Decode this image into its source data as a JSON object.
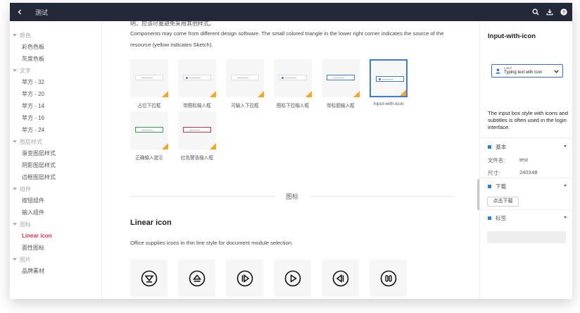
{
  "topbar": {
    "title": "测试",
    "back_icon": "chevron-left-icon",
    "actions": [
      "search-icon",
      "download-icon",
      "help-icon"
    ]
  },
  "sidebar": {
    "groups": [
      {
        "label": "颜色",
        "items": [
          "彩色色板",
          "灰度色板"
        ]
      },
      {
        "label": "文字",
        "items": [
          "苹方 - 32",
          "苹方 - 20",
          "苹方 - 14",
          "苹方 - 16",
          "苹方 - 24"
        ]
      },
      {
        "label": "图层样式",
        "items": [
          "渐变图层样式",
          "阴影图层样式",
          "边框图层样式"
        ]
      },
      {
        "label": "组件",
        "items": [
          "按钮组件",
          "输入组件"
        ]
      },
      {
        "label": "图标",
        "items": [
          "Linear icon",
          "面性图标"
        ]
      },
      {
        "label": "图片",
        "items": [
          "品牌素材"
        ]
      }
    ],
    "active_item": "Linear icon"
  },
  "main": {
    "intro_cut": "明，应该尽量避免采用其他样式。",
    "intro": "Components may come from different design software. The small colored triangle in the lower right corner indicates the source of the resource (yellow indicates Sketch).",
    "thumbnails": [
      {
        "label": "占位下拉框"
      },
      {
        "label": "带图标输入框"
      },
      {
        "label": "可输入下拉框"
      },
      {
        "label": "图标下拉输入框"
      },
      {
        "label": "带标题输入框"
      },
      {
        "label": "Input-with-icon"
      },
      {
        "label": "正确输入提示"
      },
      {
        "label": "红色警告输入框"
      }
    ],
    "divider_label": "图标",
    "section_title": "Linear icon",
    "section_desc": "Office supplies icons in thin line style for document module selection.",
    "icons": [
      "filter-circle-icon",
      "eject-circle-icon",
      "play-step-circle-icon",
      "play-circle-icon",
      "rewind-circle-icon",
      "pause-circle-icon"
    ]
  },
  "colors": {
    "topbar": "#232938",
    "active": "#e5304a",
    "accent": "#2f7fe0",
    "sketch": "#f5a623"
  },
  "detail": {
    "title": "Input-with-icon",
    "preview": {
      "label": "Label",
      "value": "Typing text with Icon"
    },
    "description": "The input box style with icons and subtitles is often used in the login interface.",
    "section_basic": "基本",
    "file_name_key": "文件名:",
    "file_name_val": "test",
    "size_key": "尺寸:",
    "size_val": "240X48",
    "section_download": "下载",
    "download_button": "点击下载",
    "section_tags": "标签"
  }
}
